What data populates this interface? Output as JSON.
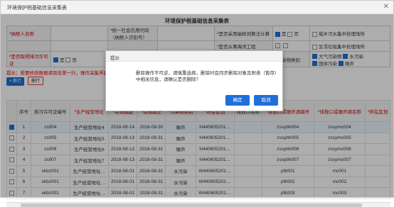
{
  "window": {
    "title": "环境保护税基础信息采集表"
  },
  "form": {
    "title": "环境保护税基础信息采集表",
    "taxpayer_name_label": "*纳税人名称",
    "taxpayer_name_value": "",
    "credit_code_label": "*统一社会信用代码（纳税人识别号）",
    "credit_code_value": "",
    "sampling_label": "*是否采用抽样测算法计算",
    "sampling_yes": "是",
    "sampling_no": "否",
    "urban_sewage_label": "城乡污水集中处理场所",
    "ocean_label": "*是否从事海洋工程",
    "waste_disposal_label": "生活垃圾集中处理场所",
    "permit_label": "*是否取得排污许可证",
    "permit_yes": "是",
    "permit_no": "否",
    "pollutant_label": "*污染物类别",
    "pollutant_air": "大气污染物",
    "pollutant_water": "水污染",
    "pollutant_solid": "固体污染",
    "pollutant_noise": "噪声"
  },
  "warning": "提示：若要修改数据请双击第一行，操作采集界面",
  "buttons": {
    "add": "+ 新行",
    "delete": "删行"
  },
  "grid": {
    "headers": [
      "",
      "序号",
      "排污许可证编号",
      "*生产经营地址",
      "*有效期起",
      "*有效期止",
      "*污染物类别",
      "*所在区划",
      "排放口名称",
      "*排放口或噪声源编号",
      "*排放口或噪声源名称",
      "*所在区划"
    ],
    "rows": [
      {
        "checked": true,
        "no": "1",
        "permit": "zs004",
        "addr": "生产经营地址4",
        "from": "2018-08-14",
        "to": "2018-08-30",
        "type": "噪声",
        "region": "N440605201…",
        "outlet": "",
        "code": "zssybh004",
        "name": "zssymc004",
        "area": ""
      },
      {
        "checked": false,
        "no": "2",
        "permit": "zs005",
        "addr": "生产经营地址5",
        "from": "2018-08-13",
        "to": "2018-08-31",
        "type": "噪声",
        "region": "N440605201…",
        "outlet": "",
        "code": "zssybh005",
        "name": "zssymc005",
        "area": ""
      },
      {
        "checked": false,
        "no": "3",
        "permit": "zs006",
        "addr": "生产经营地址6",
        "from": "2018-08-13",
        "to": "2018-08-31",
        "type": "噪声",
        "region": "N440605201…",
        "outlet": "",
        "code": "zssybh006",
        "name": "zssymc006",
        "area": ""
      },
      {
        "checked": false,
        "no": "4",
        "permit": "zs007",
        "addr": "生产经营地址7",
        "from": "2018-08-13",
        "to": "2018-08-31",
        "type": "噪声",
        "region": "N440605201…",
        "outlet": "",
        "code": "zssybh007",
        "name": "zssymc007",
        "area": ""
      },
      {
        "checked": false,
        "no": "5",
        "permit": "xkbz001",
        "addr": "生产经营地址…",
        "from": "2018-08-01",
        "to": "2018-08-31",
        "type": "水污染",
        "region": "W440605201…",
        "outlet": "",
        "code": "pfk001",
        "name": "mc001",
        "area": ""
      },
      {
        "checked": false,
        "no": "6",
        "permit": "xkbz001",
        "addr": "生产经营地址…",
        "from": "2018-08-01",
        "to": "2018-08-31",
        "type": "水污染",
        "region": "W440605201…",
        "outlet": "",
        "code": "pfk002",
        "name": "mc002",
        "area": ""
      },
      {
        "checked": false,
        "no": "7",
        "permit": "xkbz001",
        "addr": "生产经营地址…",
        "from": "2018-08-01",
        "to": "2018-08-31",
        "type": "水污染",
        "region": "W440605201…",
        "outlet": "",
        "code": "pfk003",
        "name": "mc003",
        "area": ""
      }
    ]
  },
  "dialog": {
    "title": "提示",
    "message": "删除操作不可逆，请慎重选择，删除时会同步删除对象及附表（暂存）中相关信息，请确认是否删除？",
    "ok": "确定",
    "cancel": "取消"
  },
  "colors": {
    "accent": "#1e6fd9",
    "warning": "#e00000"
  }
}
